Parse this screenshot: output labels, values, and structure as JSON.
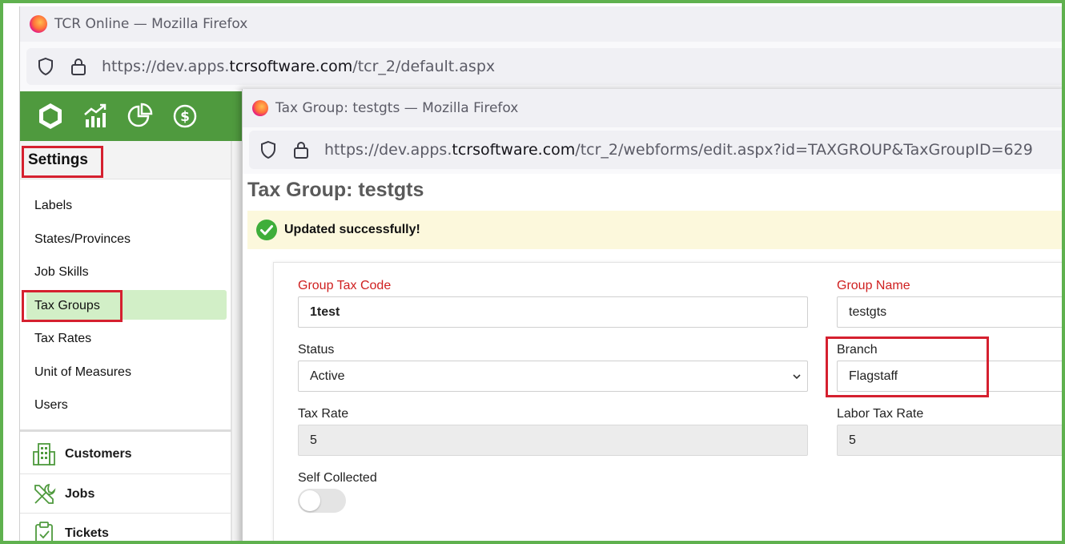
{
  "back_window": {
    "title": "TCR Online — Mozilla Firefox",
    "url_prefix": "https://dev.apps.",
    "url_domain": "tcrsoftware.com",
    "url_suffix": "/tcr_2/default.aspx"
  },
  "top_nav": {
    "icons": [
      "hexagon-logo-icon",
      "chart-icon",
      "pie-chart-icon",
      "dollar-icon"
    ]
  },
  "sidebar": {
    "header": "Settings",
    "items": [
      {
        "label": "Labels"
      },
      {
        "label": "States/Provinces"
      },
      {
        "label": "Job Skills"
      },
      {
        "label": "Tax Groups",
        "active": true
      },
      {
        "label": "Tax Rates"
      },
      {
        "label": "Unit of Measures"
      },
      {
        "label": "Users"
      }
    ],
    "sections": [
      {
        "label": "Customers",
        "icon": "building-icon"
      },
      {
        "label": "Jobs",
        "icon": "tools-icon"
      },
      {
        "label": "Tickets",
        "icon": "clipboard-icon"
      }
    ]
  },
  "front_window": {
    "title": "Tax Group: testgts — Mozilla Firefox",
    "url_prefix": "https://dev.apps.",
    "url_domain": "tcrsoftware.com",
    "url_suffix": "/tcr_2/webforms/edit.aspx?id=TAXGROUP&TaxGroupID=629"
  },
  "page": {
    "title": "Tax Group: testgts",
    "success_message": "Updated successfully!"
  },
  "form": {
    "group_tax_code": {
      "label": "Group Tax Code",
      "value": "1test"
    },
    "group_name": {
      "label": "Group Name",
      "value": "testgts"
    },
    "status": {
      "label": "Status",
      "value": "Active"
    },
    "branch": {
      "label": "Branch",
      "value": "Flagstaff"
    },
    "tax_rate": {
      "label": "Tax Rate",
      "value": "5"
    },
    "labor_tax_rate": {
      "label": "Labor Tax Rate",
      "value": "5"
    },
    "self_collected": {
      "label": "Self Collected",
      "on": false
    }
  },
  "colors": {
    "frame_green": "#5fb14e",
    "nav_green": "#4f9a3e",
    "highlight_red": "#d5202f",
    "required_red": "#cf2020",
    "active_item_bg": "#d2efc7",
    "success_bg": "#fcf8dc"
  }
}
